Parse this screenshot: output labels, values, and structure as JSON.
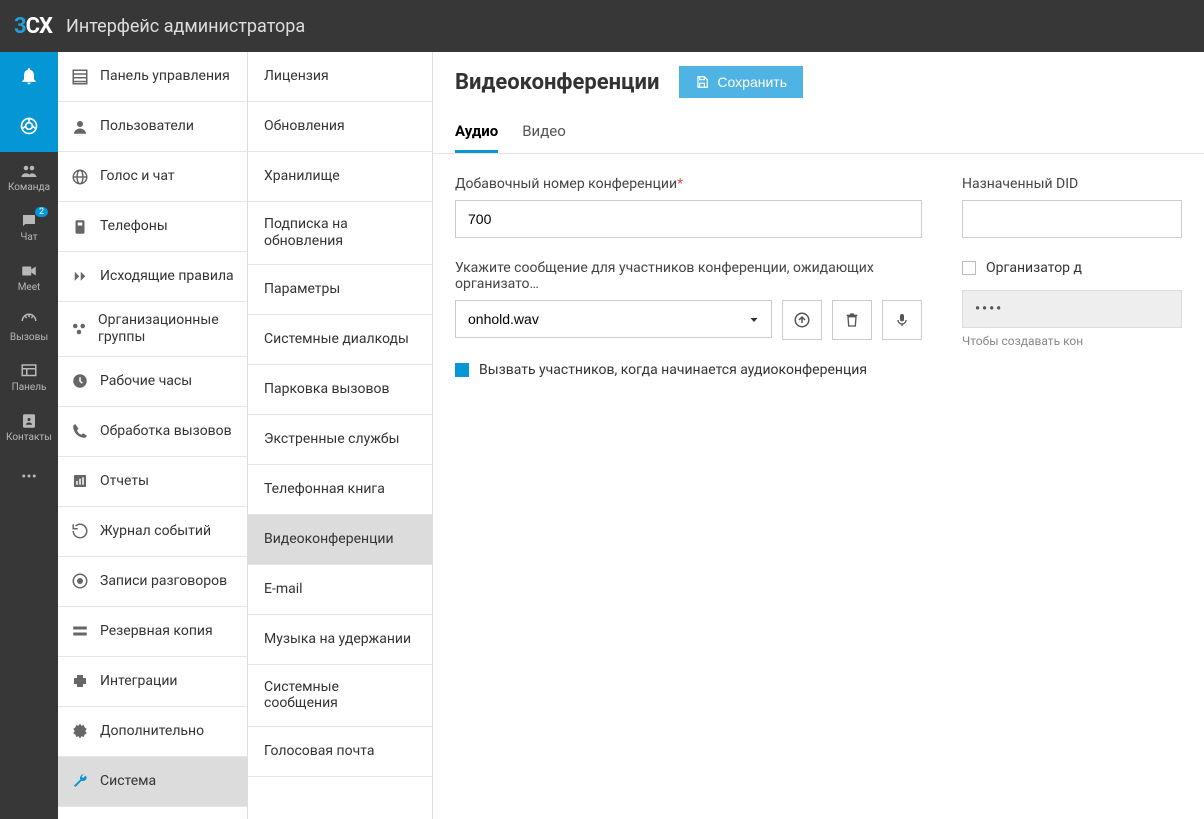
{
  "brand": {
    "part1": "3",
    "part2": "CX"
  },
  "app_title": "Интерфейс администратора",
  "rail": {
    "items": [
      {
        "label": "",
        "icon": "bell"
      },
      {
        "label": "",
        "icon": "chrome"
      },
      {
        "label": "Команда",
        "icon": "team"
      },
      {
        "label": "Чат",
        "icon": "chat",
        "badge": "2"
      },
      {
        "label": "Meet",
        "icon": "meet"
      },
      {
        "label": "Вызовы",
        "icon": "calls"
      },
      {
        "label": "Панель",
        "icon": "panel"
      },
      {
        "label": "Контакты",
        "icon": "contacts"
      },
      {
        "label": "",
        "icon": "dots"
      }
    ]
  },
  "nav1": [
    {
      "label": "Панель управления",
      "icon": "dashboard"
    },
    {
      "label": "Пользователи",
      "icon": "user"
    },
    {
      "label": "Голос и чат",
      "icon": "globe"
    },
    {
      "label": "Телефоны",
      "icon": "phones"
    },
    {
      "label": "Исходящие правила",
      "icon": "outgoing"
    },
    {
      "label": "Организационные группы",
      "icon": "groups"
    },
    {
      "label": "Рабочие часы",
      "icon": "clock"
    },
    {
      "label": "Обработка вызовов",
      "icon": "handset"
    },
    {
      "label": "Отчеты",
      "icon": "reports"
    },
    {
      "label": "Журнал событий",
      "icon": "log"
    },
    {
      "label": "Записи разговоров",
      "icon": "rec"
    },
    {
      "label": "Резервная копия",
      "icon": "backup"
    },
    {
      "label": "Интеграции",
      "icon": "puzzle"
    },
    {
      "label": "Дополнительно",
      "icon": "gear"
    },
    {
      "label": "Система",
      "icon": "wrench",
      "active": true
    }
  ],
  "nav2": [
    {
      "label": "Лицензия"
    },
    {
      "label": "Обновления"
    },
    {
      "label": "Хранилище"
    },
    {
      "label": "Подписка на обновления"
    },
    {
      "label": "Параметры"
    },
    {
      "label": "Системные диалкоды"
    },
    {
      "label": "Парковка вызовов"
    },
    {
      "label": "Экстренные службы"
    },
    {
      "label": "Телефонная книга"
    },
    {
      "label": "Видеоконференции",
      "active": true
    },
    {
      "label": "E-mail"
    },
    {
      "label": "Музыка на удержании"
    },
    {
      "label": "Системные сообщения"
    },
    {
      "label": "Голосовая почта"
    }
  ],
  "page": {
    "title": "Видеоконференции",
    "save_label": "Сохранить"
  },
  "tabs": {
    "audio": "Аудио",
    "video": "Видео"
  },
  "form": {
    "ext_label": "Добавочный номер конференции",
    "ext_value": "700",
    "msg_label": "Укажите сообщение для участников конференции, ожидающих организато…",
    "msg_value": "onhold.wav",
    "callout_label": "Вызвать участников, когда начинается аудиоконференция",
    "did_label": "Назначенный DID",
    "did_value": "",
    "organizer_label": "Организатор д",
    "pin_value": "••••",
    "pin_hint": "Чтобы создавать кон"
  }
}
